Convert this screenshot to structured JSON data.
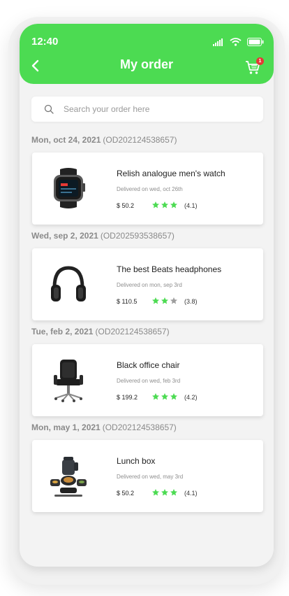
{
  "status_bar": {
    "time": "12:40"
  },
  "header": {
    "title": "My order",
    "cart_badge": "1"
  },
  "search": {
    "placeholder": "Search your order here"
  },
  "colors": {
    "accent": "#4cdb52",
    "star_filled": "#4cdb52",
    "star_empty": "#9e9e9e",
    "badge": "#e53935"
  },
  "orders": [
    {
      "date": "Mon, oct 24, 2021",
      "order_id": "(OD202124538657)",
      "name": "Relish analogue men's watch",
      "delivery": "Delivered on wed, oct 26th",
      "price": "$ 50.2",
      "rating": 4.1,
      "rating_text": "(4.1)",
      "icon": "smartwatch-icon"
    },
    {
      "date": "Wed, sep 2, 2021",
      "order_id": "(OD202593538657)",
      "name": "The best Beats headphones",
      "delivery": "Delivered on mon, sep 3rd",
      "price": "$ 110.5",
      "rating": 3.8,
      "rating_text": "(3.8)",
      "icon": "headphones-icon"
    },
    {
      "date": "Tue, feb 2, 2021",
      "order_id": "(OD202124538657)",
      "name": "Black office chair",
      "delivery": "Delivered on wed, feb 3rd",
      "price": "$ 199.2",
      "rating": 4.2,
      "rating_text": "(4.2)",
      "icon": "office-chair-icon"
    },
    {
      "date": "Mon, may 1, 2021",
      "order_id": "(OD202124538657)",
      "name": "Lunch box",
      "delivery": "Delivered on wed, may 3rd",
      "price": "$ 50.2",
      "rating": 4.1,
      "rating_text": "(4.1)",
      "icon": "lunch-box-icon"
    }
  ],
  "star_counts": [
    {
      "filled": 3,
      "total": 3
    },
    {
      "filled": 2,
      "total": 3
    },
    {
      "filled": 3,
      "total": 3
    },
    {
      "filled": 3,
      "total": 3
    }
  ]
}
